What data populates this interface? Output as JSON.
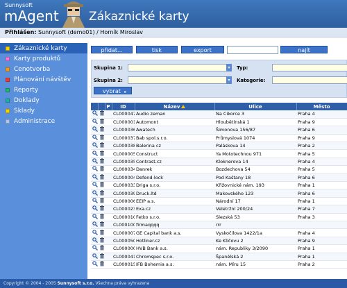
{
  "header": {
    "brand_top": "Sunnysoft",
    "brand_main": "mAgent",
    "title": "Zákaznické karty"
  },
  "userbar": {
    "label": "Přihlášen:",
    "value": "Sunnysoft (demo01) / Horník Miroslav"
  },
  "sidebar": {
    "items": [
      {
        "label": "Zákaznické karty",
        "color": "#f5d100"
      },
      {
        "label": "Karty produktů",
        "color": "#f17ad6"
      },
      {
        "label": "Cenotvorba",
        "color": "#f09a19"
      },
      {
        "label": "Plánování návštěv",
        "color": "#ee3b3b"
      },
      {
        "label": "Reporty",
        "color": "#20b56b"
      },
      {
        "label": "Doklady",
        "color": "#1eb0a3"
      },
      {
        "label": "Sklady",
        "color": "#f5d100"
      },
      {
        "label": "Administrace",
        "color": "#b6c8ea"
      }
    ]
  },
  "toolbar": {
    "add_label": "přidat...",
    "print_label": "tisk",
    "export_label": "export",
    "find_label": "najít",
    "search_value": ""
  },
  "filters": {
    "group1_label": "Skupina 1:",
    "group2_label": "Skupina 2:",
    "type_label": "Typ:",
    "category_label": "Kategorie:",
    "select_label": "vybrat"
  },
  "table": {
    "headers": {
      "p": "P",
      "id": "ID",
      "name": "Název",
      "street": "Ulice",
      "city": "Město"
    },
    "rows": [
      {
        "id": "CL000047",
        "name": "Audio zeman",
        "street": "Na Cikorce 3",
        "city": "Praha 4"
      },
      {
        "id": "CL000001",
        "name": "Automont",
        "street": "Hloubětínská 1",
        "city": "Praha 9"
      },
      {
        "id": "CL000036",
        "name": "Awatech",
        "street": "Šimonova 156/87",
        "city": "Praha 6"
      },
      {
        "id": "CL000037",
        "name": "Bab spol.s.r.o.",
        "street": "Průmyslová 1074",
        "city": "Praha 9"
      },
      {
        "id": "CL000038",
        "name": "Balerina cz",
        "street": "Paláskova 14",
        "city": "Praha 2"
      },
      {
        "id": "CL000005",
        "name": "Construct",
        "street": "Ya Mototechnou 971",
        "city": "Praha 5"
      },
      {
        "id": "CL000035",
        "name": "Contrast.cz",
        "street": "Kloknerova 14",
        "city": "Praha 4"
      },
      {
        "id": "CL000034",
        "name": "Danrek",
        "street": "Bozdechova 54",
        "city": "Praha 5"
      },
      {
        "id": "CL000004",
        "name": "Defend-lock",
        "street": "Pod Kaštany 18",
        "city": "Praha 6"
      },
      {
        "id": "CL000033",
        "name": "Driga s.r.o.",
        "street": "Křižovnické nám. 193",
        "city": "Praha 1"
      },
      {
        "id": "CL000039",
        "name": "Druck.ltd",
        "street": "Makovského 123",
        "city": "Praha 6"
      },
      {
        "id": "CL000006",
        "name": "EEIP a.s.",
        "street": "Národní 17",
        "city": "Praha 1"
      },
      {
        "id": "CL000023",
        "name": "Exa.cz",
        "street": "Veletržní 200/24",
        "city": "Praha 7"
      },
      {
        "id": "CL000010",
        "name": "Fetko s.r.o.",
        "street": "Slezská 53",
        "city": "Praha 3"
      },
      {
        "id": "CL0001001",
        "name": "firmaqqqq",
        "street": "rrr",
        "city": ""
      },
      {
        "id": "CL000007",
        "name": "GE Capital bank a.s.",
        "street": "Vyskočilova 1422/1a",
        "city": "Praha 4"
      },
      {
        "id": "CL000050",
        "name": "Hotliner.cz",
        "street": "Ke Klíčovu 2",
        "city": "Praha 9"
      },
      {
        "id": "CL000000",
        "name": "HVB Bank a.s.",
        "street": "nám. Republiky 3/2090",
        "city": "Praha 1"
      },
      {
        "id": "CL000041",
        "name": "Chromspec s.r.o.",
        "street": "Španělská 2",
        "city": "Praha 1"
      },
      {
        "id": "CL000015",
        "name": "IFB Bohemia a.s.",
        "street": "nám. Míru 15",
        "city": "Praha 2"
      }
    ]
  },
  "footer": {
    "prefix": "Copyright © 2004 - 2005",
    "company": "Sunnysoft s.r.o.",
    "suffix": "Všechna práva vyhrazena"
  }
}
